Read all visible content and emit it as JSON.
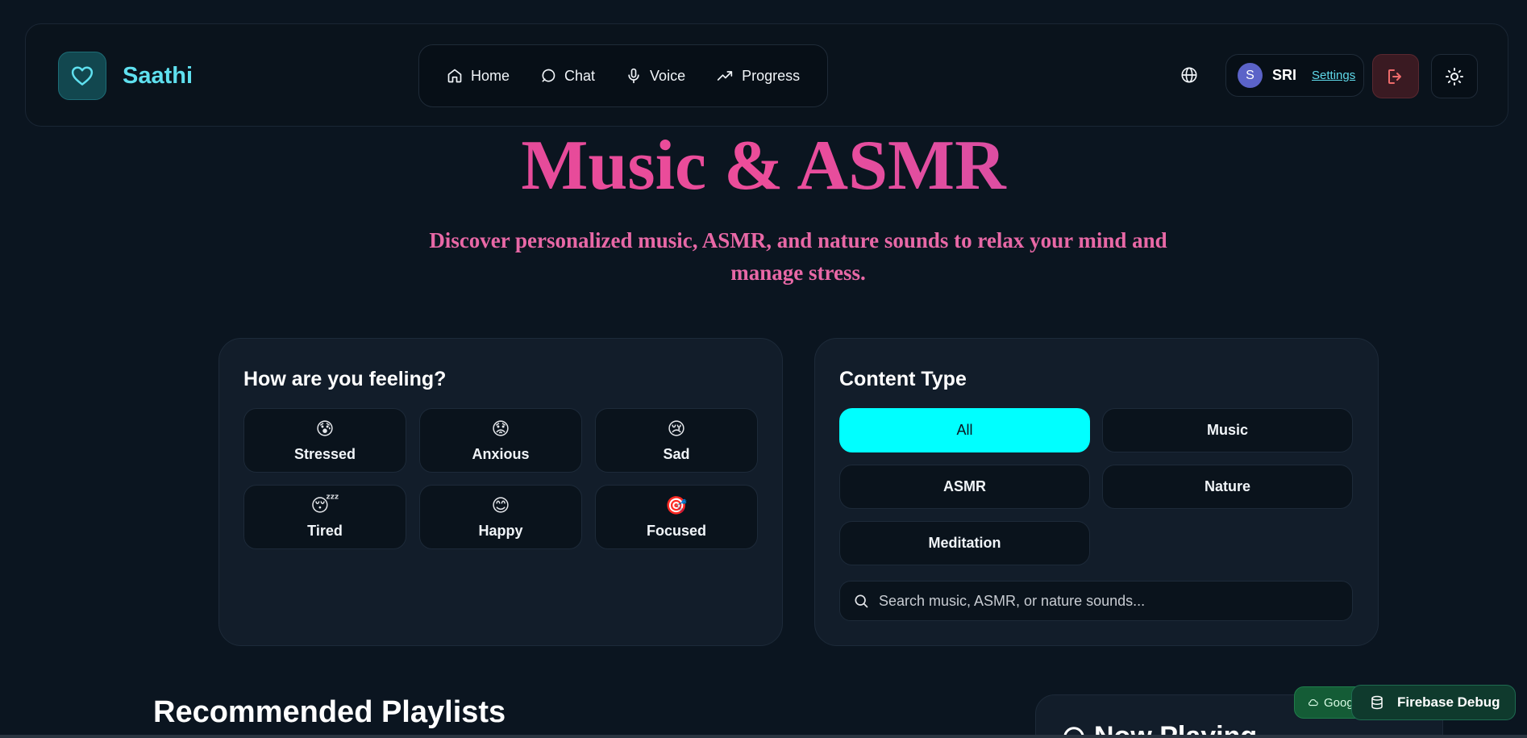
{
  "app": {
    "name": "Saathi"
  },
  "nav": {
    "links": [
      {
        "label": "Home",
        "icon": "home-icon"
      },
      {
        "label": "Chat",
        "icon": "chat-icon"
      },
      {
        "label": "Voice",
        "icon": "mic-icon"
      },
      {
        "label": "Progress",
        "icon": "trending-up-icon"
      }
    ]
  },
  "user": {
    "initial": "S",
    "name": "SRI",
    "settings_label": "Settings"
  },
  "hero": {
    "title": "Music & ASMR",
    "subtitle": "Discover personalized music, ASMR, and nature sounds to relax your mind and manage stress."
  },
  "mood": {
    "title": "How are you feeling?",
    "options": [
      {
        "emoji": "😰",
        "label": "Stressed"
      },
      {
        "emoji": "😟",
        "label": "Anxious"
      },
      {
        "emoji": "😢",
        "label": "Sad"
      },
      {
        "emoji": "😴",
        "label": "Tired"
      },
      {
        "emoji": "😊",
        "label": "Happy"
      },
      {
        "emoji": "🎯",
        "label": "Focused"
      }
    ]
  },
  "content_type": {
    "title": "Content Type",
    "options": [
      "All",
      "Music",
      "ASMR",
      "Nature",
      "Meditation"
    ],
    "selected": "All",
    "search_placeholder": "Search music, ASMR, or nature sounds..."
  },
  "recommended": {
    "title": "Recommended Playlists"
  },
  "now_playing": {
    "title": "Now Playing"
  },
  "debug": {
    "google_label": "Google",
    "firebase_label": "Firebase Debug"
  },
  "colors": {
    "background": "#0b1520",
    "accent_cyan": "#00ffff",
    "brand_cyan": "#5fe0ef",
    "hero_pink": "#e868a6"
  }
}
